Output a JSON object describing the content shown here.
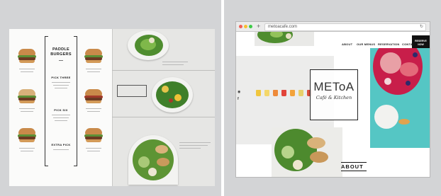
{
  "menu": {
    "title_line1": "PADDLE",
    "title_line2": "BURGERS",
    "sections": [
      {
        "head": "PICK THREE",
        "price": "—"
      },
      {
        "head": "PICK SIX",
        "price": "—"
      },
      {
        "head": "EXTRA PICK",
        "price": "—"
      }
    ]
  },
  "browser": {
    "url": "metoacafe.com",
    "nav": [
      "ABOUT",
      "OUR MENUS",
      "RESERVATION",
      "CONTACT"
    ],
    "reserve_line1": "RESERVE",
    "reserve_line2": "NOW",
    "logo_main": "METoA",
    "logo_sub": "Café & Kitchen",
    "section_label": "ABOUT"
  },
  "icons": {
    "window_close": "red-dot",
    "window_min": "yellow-dot",
    "window_max": "green-dot",
    "new_tab": "plus-icon",
    "reload": "reload-icon",
    "social": [
      "instagram-icon",
      "facebook-icon"
    ]
  },
  "colors": {
    "hero_teal": "#55c6c4",
    "nav_dark": "#111111",
    "panel_bg": "#d3d4d6"
  }
}
